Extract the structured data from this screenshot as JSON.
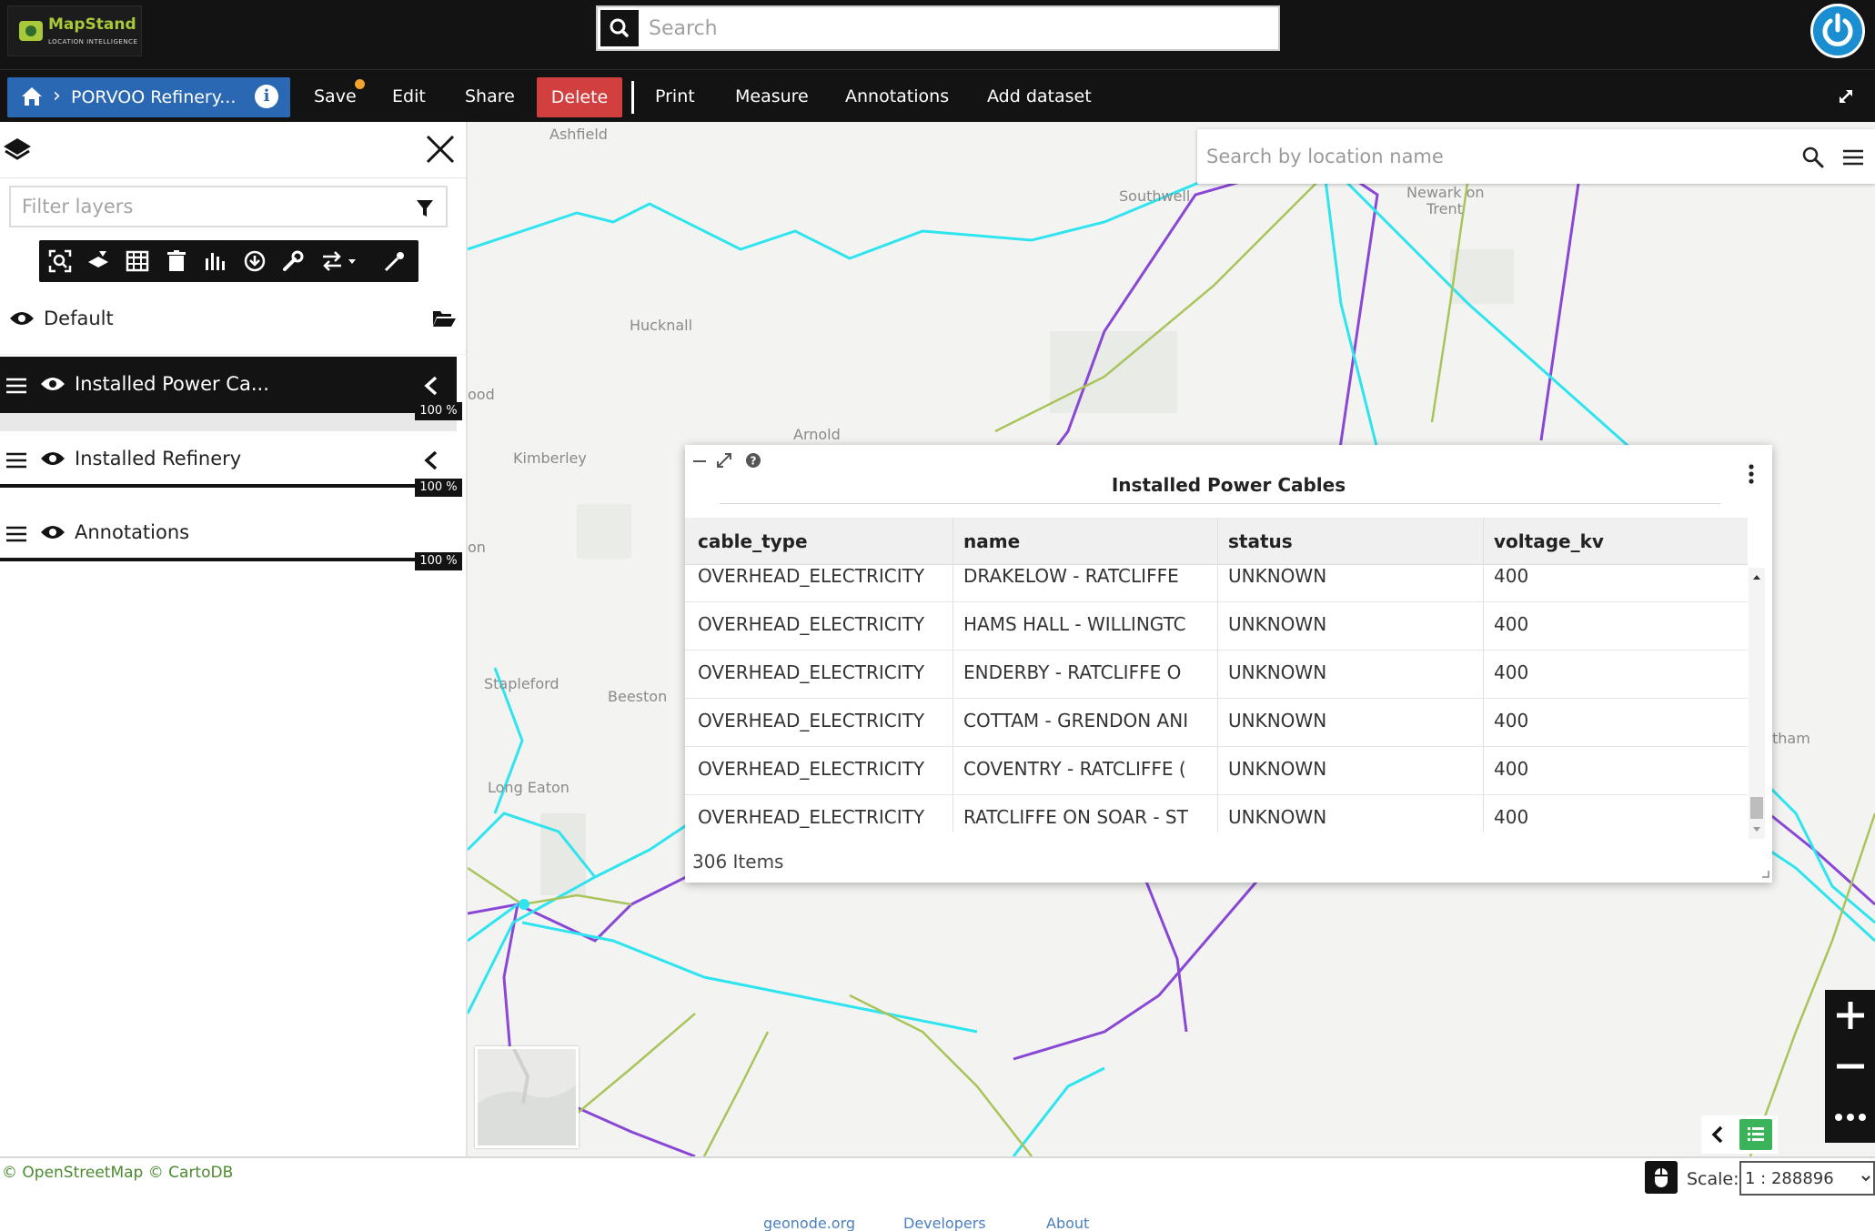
{
  "topbar": {
    "logo_brand": "MapStand",
    "logo_tagline": "LOCATION INTELLIGENCE",
    "search_placeholder": "Search"
  },
  "menubar": {
    "map_title": "PORVOO Refinery...",
    "items": [
      "Save",
      "Edit",
      "Share",
      "Delete",
      "Print",
      "Measure",
      "Annotations",
      "Add dataset"
    ],
    "accent_color": "#2a68b3",
    "delete_color": "#d23f3f",
    "unsaved_dot_color": "#f2a32e"
  },
  "location_search": {
    "placeholder": "Search by location name"
  },
  "layers_panel": {
    "filter_placeholder": "Filter layers",
    "toolbar_icons": [
      "zoom-to-extent-icon",
      "layer-style-icon",
      "attribute-table-icon",
      "delete-icon",
      "chart-icon",
      "download-icon",
      "settings-wrench-icon",
      "swap-icon",
      "eyedropper-icon"
    ],
    "default_group": "Default",
    "layers": [
      {
        "name": "Installed Power Ca...",
        "opacity": "100 %",
        "selected": true
      },
      {
        "name": "Installed Refinery",
        "opacity": "100 %",
        "selected": false
      },
      {
        "name": "Annotations",
        "opacity": "100 %",
        "selected": false
      }
    ]
  },
  "map": {
    "places": [
      "Ashfield",
      "Southwell",
      "Newark on",
      "Trent",
      "Hucknall",
      "ood",
      "Arnold",
      "Kimberley",
      "on",
      "Stapleford",
      "Beeston",
      "Long Eaton",
      "tham"
    ],
    "colors": {
      "cable_cyan": "#2ee4ef",
      "cable_purple": "#8a47d6",
      "cable_green": "#a9c45a"
    }
  },
  "attribute_table": {
    "title": "Installed Power Cables",
    "columns": [
      "cable_type",
      "name",
      "status",
      "voltage_kv"
    ],
    "rows": [
      [
        "OVERHEAD_ELECTRICITY",
        "DRAKELOW - RATCLIFFE",
        "UNKNOWN",
        "400"
      ],
      [
        "OVERHEAD_ELECTRICITY",
        "HAMS HALL - WILLINGTC",
        "UNKNOWN",
        "400"
      ],
      [
        "OVERHEAD_ELECTRICITY",
        "ENDERBY - RATCLIFFE O",
        "UNKNOWN",
        "400"
      ],
      [
        "OVERHEAD_ELECTRICITY",
        "COTTAM - GRENDON ANI",
        "UNKNOWN",
        "400"
      ],
      [
        "OVERHEAD_ELECTRICITY",
        "COVENTRY - RATCLIFFE (",
        "UNKNOWN",
        "400"
      ],
      [
        "OVERHEAD_ELECTRICITY",
        "RATCLIFFE ON SOAR - ST",
        "UNKNOWN",
        "400"
      ]
    ],
    "item_count": "306 Items"
  },
  "bottombar": {
    "attribution_osm": "© OpenStreetMap",
    "attribution_carto": "© CartoDB",
    "links": [
      "geonode.org",
      "Developers",
      "About"
    ],
    "scale_label": "Scale:",
    "scale_value": "1 : 288896"
  }
}
